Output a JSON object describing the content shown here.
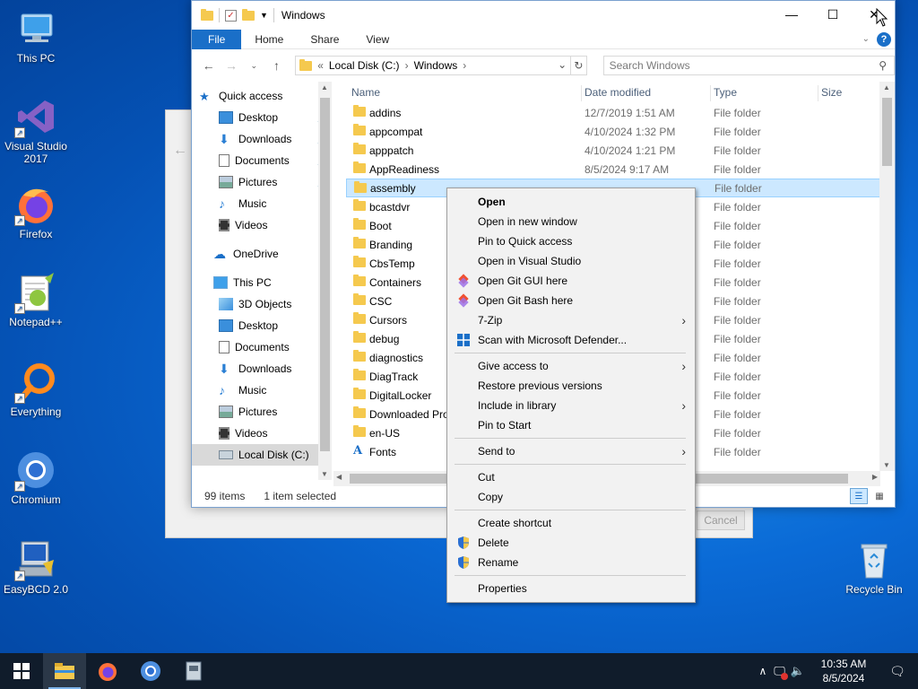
{
  "desktop": {
    "icons": [
      {
        "label": "This PC",
        "icon": "this-pc-icon"
      },
      {
        "label": "Visual Studio 2017",
        "icon": "visual-studio-icon"
      },
      {
        "label": "Firefox",
        "icon": "firefox-icon"
      },
      {
        "label": "Notepad++",
        "icon": "notepadpp-icon"
      },
      {
        "label": "Everything",
        "icon": "everything-icon"
      },
      {
        "label": "Chromium",
        "icon": "chromium-icon"
      },
      {
        "label": "EasyBCD 2.0",
        "icon": "easybcd-icon"
      },
      {
        "label": "Recycle Bin",
        "icon": "recycle-bin-icon"
      }
    ]
  },
  "background_dialog": {
    "cancel_label": "Cancel"
  },
  "explorer": {
    "title": "Windows",
    "ribbon_tabs": [
      "File",
      "Home",
      "Share",
      "View"
    ],
    "address": {
      "prefix": "«",
      "parts": [
        "Local Disk (C:)",
        "Windows"
      ]
    },
    "search_placeholder": "Search Windows",
    "nav": {
      "quick_access": "Quick access",
      "quick_items": [
        {
          "label": "Desktop",
          "pinned": true
        },
        {
          "label": "Downloads",
          "pinned": true
        },
        {
          "label": "Documents",
          "pinned": true
        },
        {
          "label": "Pictures",
          "pinned": true
        },
        {
          "label": "Music",
          "pinned": false
        },
        {
          "label": "Videos",
          "pinned": false
        }
      ],
      "onedrive": "OneDrive",
      "this_pc": "This PC",
      "pc_items": [
        "3D Objects",
        "Desktop",
        "Documents",
        "Downloads",
        "Music",
        "Pictures",
        "Videos",
        "Local Disk (C:)"
      ]
    },
    "columns": {
      "name": "Name",
      "date": "Date modified",
      "type": "Type",
      "size": "Size"
    },
    "files": [
      {
        "name": "addins",
        "date": "12/7/2019 1:51 AM",
        "type": "File folder"
      },
      {
        "name": "appcompat",
        "date": "4/10/2024 1:32 PM",
        "type": "File folder"
      },
      {
        "name": "apppatch",
        "date": "4/10/2024 1:21 PM",
        "type": "File folder"
      },
      {
        "name": "AppReadiness",
        "date": "8/5/2024 9:17 AM",
        "type": "File folder"
      },
      {
        "name": "assembly",
        "date": "",
        "type": "File folder",
        "selected": true
      },
      {
        "name": "bcastdvr",
        "date": "",
        "type": "File folder"
      },
      {
        "name": "Boot",
        "date": "",
        "type": "File folder"
      },
      {
        "name": "Branding",
        "date": "",
        "type": "File folder"
      },
      {
        "name": "CbsTemp",
        "date": "",
        "type": "File folder"
      },
      {
        "name": "Containers",
        "date": "",
        "type": "File folder"
      },
      {
        "name": "CSC",
        "date": "",
        "type": "File folder"
      },
      {
        "name": "Cursors",
        "date": "",
        "type": "File folder"
      },
      {
        "name": "debug",
        "date": "",
        "type": "File folder"
      },
      {
        "name": "diagnostics",
        "date": "",
        "type": "File folder"
      },
      {
        "name": "DiagTrack",
        "date": "",
        "type": "File folder"
      },
      {
        "name": "DigitalLocker",
        "date": "",
        "type": "File folder"
      },
      {
        "name": "Downloaded Pro",
        "date": "",
        "type": "File folder"
      },
      {
        "name": "en-US",
        "date": "",
        "type": "File folder"
      },
      {
        "name": "Fonts",
        "date": "",
        "type": "File folder",
        "font_icon": true
      }
    ],
    "status": {
      "count": "99 items",
      "selected": "1 item selected"
    }
  },
  "context_menu": {
    "groups": [
      [
        {
          "label": "Open",
          "bold": true
        },
        {
          "label": "Open in new window"
        },
        {
          "label": "Pin to Quick access"
        },
        {
          "label": "Open in Visual Studio"
        },
        {
          "label": "Open Git GUI here",
          "icon": "git-icon"
        },
        {
          "label": "Open Git Bash here",
          "icon": "git-icon"
        },
        {
          "label": "7-Zip",
          "submenu": true
        },
        {
          "label": "Scan with Microsoft Defender...",
          "icon": "defender-icon"
        }
      ],
      [
        {
          "label": "Give access to",
          "submenu": true
        },
        {
          "label": "Restore previous versions"
        },
        {
          "label": "Include in library",
          "submenu": true
        },
        {
          "label": "Pin to Start"
        }
      ],
      [
        {
          "label": "Send to",
          "submenu": true
        }
      ],
      [
        {
          "label": "Cut"
        },
        {
          "label": "Copy"
        }
      ],
      [
        {
          "label": "Create shortcut"
        },
        {
          "label": "Delete",
          "icon": "shield-icon"
        },
        {
          "label": "Rename",
          "icon": "shield-icon"
        }
      ],
      [
        {
          "label": "Properties"
        }
      ]
    ]
  },
  "taskbar": {
    "apps": [
      "file-explorer-icon",
      "firefox-icon",
      "chromium-icon",
      "app-icon"
    ],
    "clock": {
      "time": "10:35 AM",
      "date": "8/5/2024"
    }
  }
}
